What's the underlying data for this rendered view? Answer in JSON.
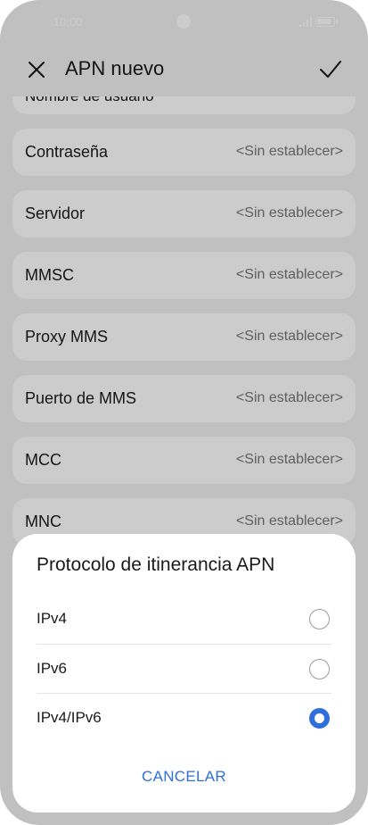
{
  "status_bar": {
    "time": "10:00"
  },
  "header": {
    "title": "APN nuevo"
  },
  "list": {
    "cut_label": "Nombre de usuario",
    "rows": [
      {
        "label": "Contraseña",
        "value": "<Sin establecer>"
      },
      {
        "label": "Servidor",
        "value": "<Sin establecer>"
      },
      {
        "label": "MMSC",
        "value": "<Sin establecer>"
      },
      {
        "label": "Proxy MMS",
        "value": "<Sin establecer>"
      },
      {
        "label": "Puerto de MMS",
        "value": "<Sin establecer>"
      },
      {
        "label": "MCC",
        "value": "<Sin establecer>"
      },
      {
        "label": "MNC",
        "value": "<Sin establecer>"
      }
    ]
  },
  "dialog": {
    "title": "Protocolo de itinerancia APN",
    "options": [
      {
        "label": "IPv4",
        "selected": false
      },
      {
        "label": "IPv6",
        "selected": false
      },
      {
        "label": "IPv4/IPv6",
        "selected": true
      }
    ],
    "cancel_label": "CANCELAR"
  },
  "colors": {
    "accent": "#2f6fdd",
    "background": "#f0f0f0",
    "card": "#ffffff"
  }
}
